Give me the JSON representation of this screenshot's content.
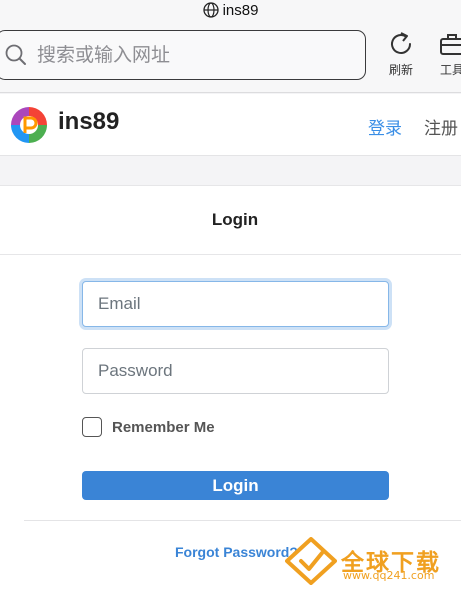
{
  "browser": {
    "domain": "ins89",
    "search_placeholder": "搜索或输入网址",
    "refresh_label": "刷新",
    "tools_label": "工具"
  },
  "site": {
    "brand": "ins89",
    "nav_login": "登录",
    "nav_register": "注册"
  },
  "login_card": {
    "title": "Login",
    "email_placeholder": "Email",
    "password_placeholder": "Password",
    "remember_label": "Remember Me",
    "submit_label": "Login",
    "forgot_label": "Forgot Password?"
  },
  "watermark": {
    "text": "全球下载",
    "url": "www.qq241.com"
  },
  "colors": {
    "accent": "#3a84d6",
    "nav_link": "#3a8ee6",
    "watermark": "#f0a020"
  }
}
